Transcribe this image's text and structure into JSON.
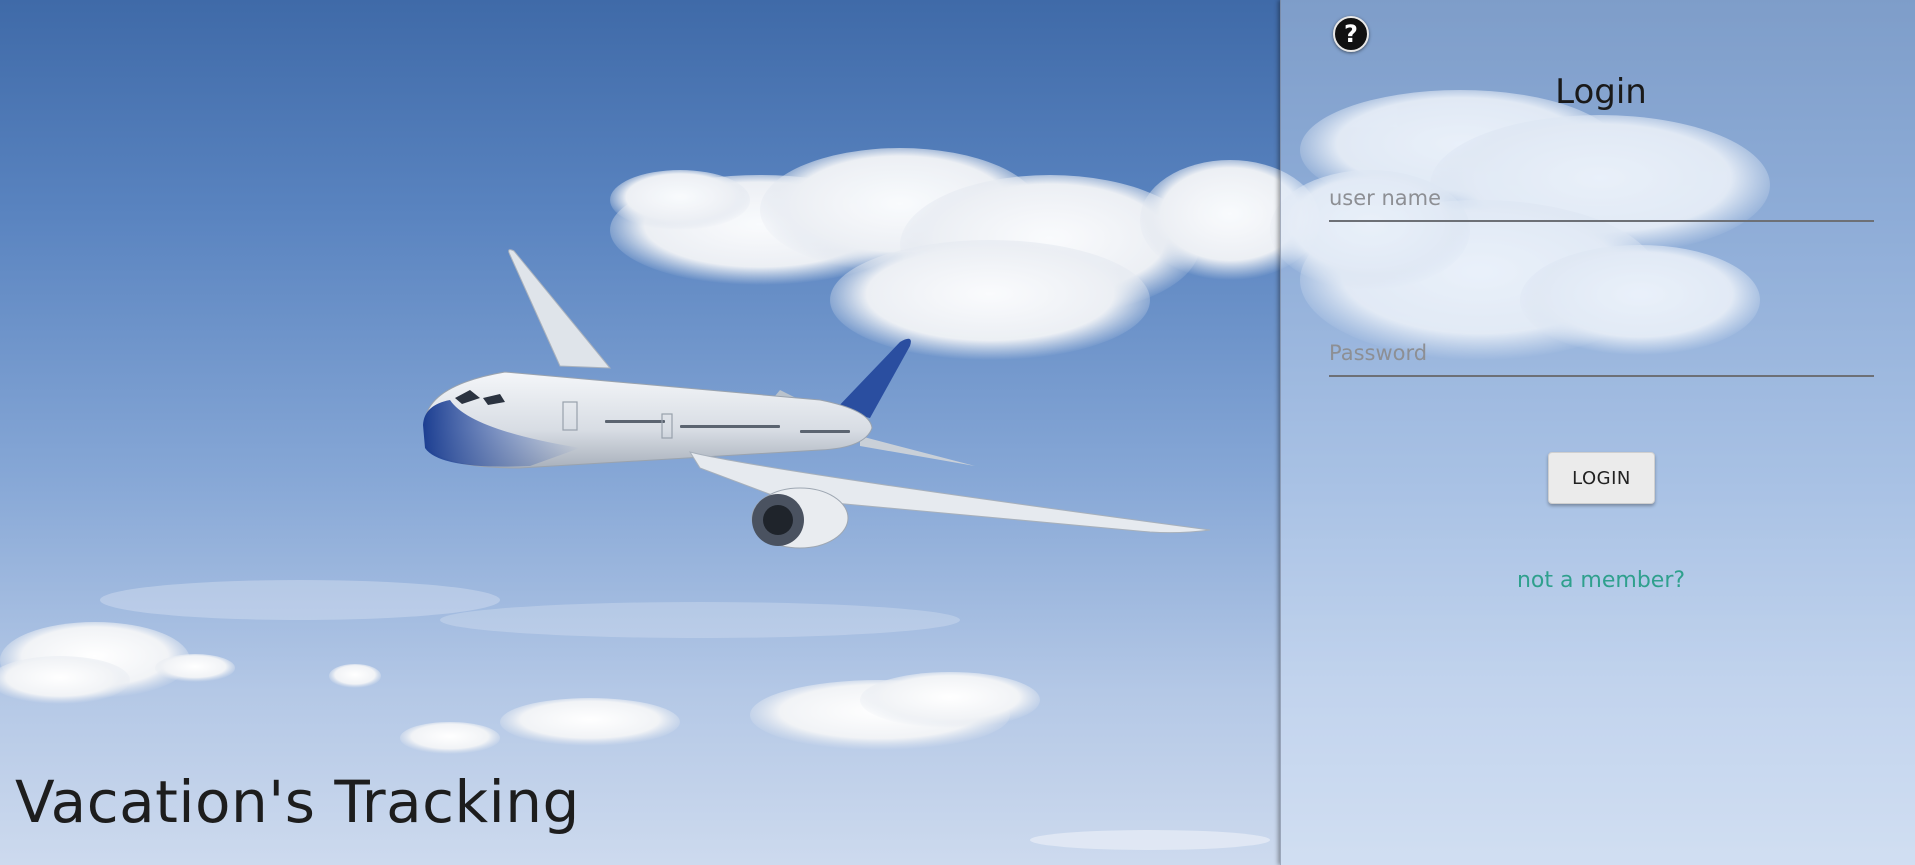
{
  "app": {
    "title": "Vacation's Tracking"
  },
  "login": {
    "heading": "Login",
    "help_icon": "question-mark-icon",
    "help_glyph": "?",
    "username": {
      "placeholder": "user name",
      "value": ""
    },
    "password": {
      "placeholder": "Password",
      "value": ""
    },
    "submit_label": "LOGIN",
    "signup_link": "not a member?"
  },
  "colors": {
    "link": "#2fa08d",
    "heading": "#1a1a1a",
    "button_bg": "#ebebeb",
    "sky_top": "#3f6aa8",
    "sky_bottom": "#cddaee"
  }
}
